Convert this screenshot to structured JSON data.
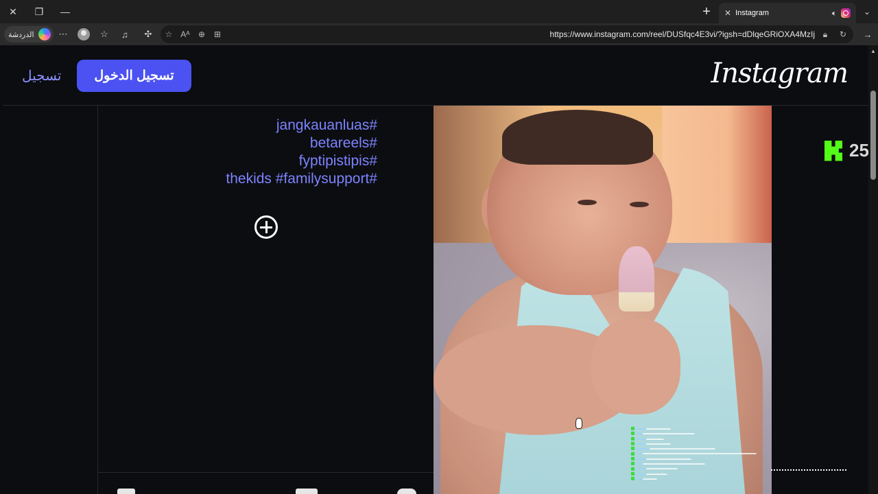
{
  "browser": {
    "tab": {
      "title": "Instagram",
      "favicon": "instagram-icon"
    },
    "copilot_label": "الدردشة",
    "url": "https://www.instagram.com/reel/DUSfqc4E3vi/?igsh=dDlqeGRiOXA4MzIj",
    "icons": [
      "close-window-icon",
      "restore-icon",
      "minimize-icon",
      "new-tab-icon",
      "tab-dropdown-icon",
      "more-icon",
      "profile-icon",
      "favorites-icon",
      "collections-icon",
      "extensions-icon",
      "star-icon",
      "read-aloud-icon",
      "zoom-icon",
      "split-screen-icon",
      "lock-icon",
      "refresh-icon",
      "forward-icon"
    ]
  },
  "header": {
    "logo": "Instagram",
    "login_label": "تسجيل الدخول",
    "signup_label": "تسجيل"
  },
  "caption": {
    "lines": [
      "jangkauanluas#",
      "betareels#",
      "fyptipistipis#",
      "thekids #familysupport#"
    ]
  },
  "overlay": {
    "kick_count": "25"
  }
}
